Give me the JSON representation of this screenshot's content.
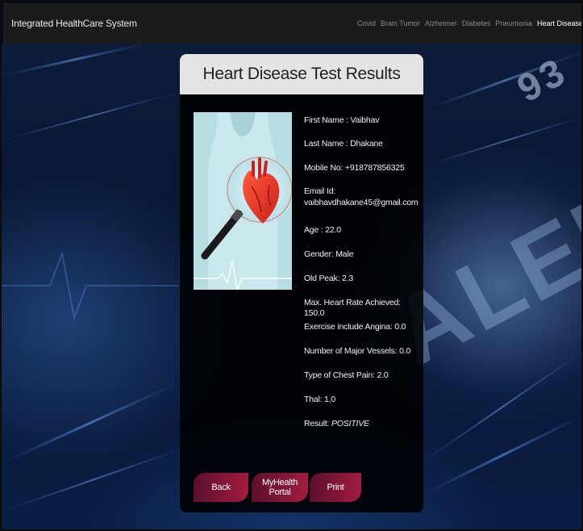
{
  "navbar": {
    "brand": "Integrated HealthCare System",
    "links": [
      "Covid",
      "Brain Tumor",
      "Alzheimer",
      "Diabetes",
      "Pneumonia",
      "Heart Disease"
    ],
    "active": "Heart Disease"
  },
  "background": {
    "big_word": "ALERT",
    "corner_number": "93"
  },
  "card": {
    "title": "Heart Disease Test Results",
    "image_icon": "heart-magnifier-illustration",
    "fields": [
      "First Name : Vaibhav",
      "Last Name : Dhakane",
      "Mobile No: +918787856325",
      "Email Id:",
      "vaibhavdhakane45@gmail.com",
      "Age : 22.0",
      "Gender: Male",
      "Old Peak: 2.3",
      "Max. Heart Rate Achieved: 150.0",
      "Exercise include Angina: 0.0",
      "Number of Major Vessels: 0.0",
      "Type of Chest Pain: 2.0",
      "Thal: 1.0"
    ],
    "result_label": "Result: ",
    "result_value": "POSITIVE",
    "buttons": {
      "back": "Back",
      "portal": "MyHealth Portal",
      "print": "Print"
    }
  },
  "colors": {
    "navbar_bg": "#1b1b1b",
    "card_header_bg": "#e4e4e4",
    "button_gradient_start": "#5c0f2e",
    "button_gradient_end": "#a31c3e"
  }
}
